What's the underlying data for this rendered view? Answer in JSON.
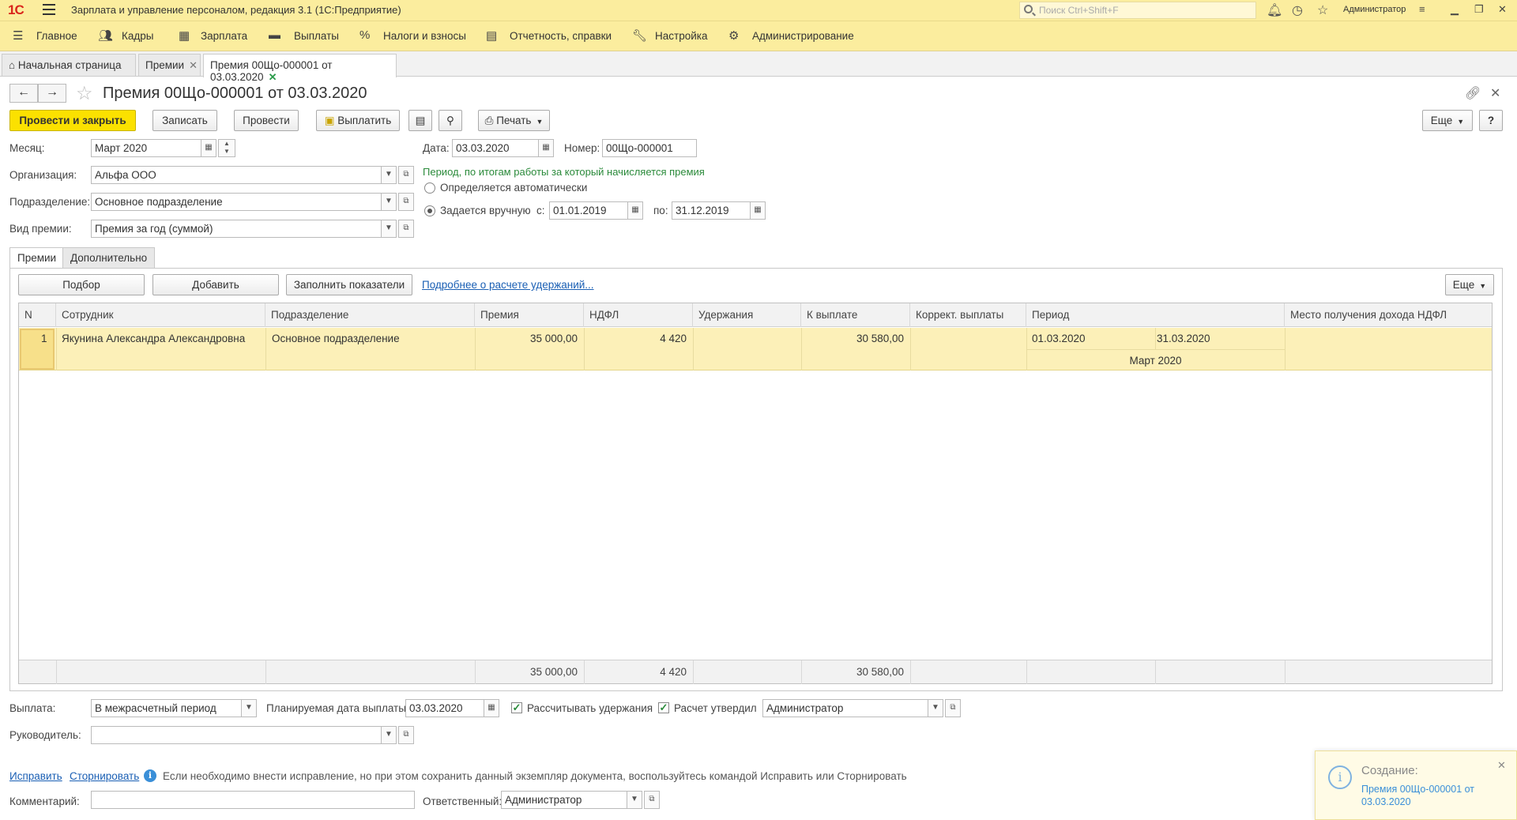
{
  "app": {
    "logo": "1С",
    "title": "Зарплата и управление персоналом, редакция 3.1  (1С:Предприятие)",
    "search_placeholder": "Поиск Ctrl+Shift+F",
    "user": "Администратор"
  },
  "main_menu": [
    {
      "label": "Главное",
      "icon": "menu-icon"
    },
    {
      "label": "Кадры",
      "icon": "people-icon"
    },
    {
      "label": "Зарплата",
      "icon": "calculator-icon"
    },
    {
      "label": "Выплаты",
      "icon": "wallet-icon"
    },
    {
      "label": "Налоги и взносы",
      "icon": "percent-icon"
    },
    {
      "label": "Отчетность, справки",
      "icon": "reports-icon"
    },
    {
      "label": "Настройка",
      "icon": "wrench-icon"
    },
    {
      "label": "Администрирование",
      "icon": "gear-icon"
    }
  ],
  "open_tabs": [
    {
      "label": "Начальная страница"
    },
    {
      "label": "Премии"
    },
    {
      "label": "Премия 00Що-000001 от 03.03.2020",
      "active": true
    }
  ],
  "form": {
    "title": "Премия 00Що-000001 от 03.03.2020",
    "buttons": {
      "post_close": "Провести и закрыть",
      "save": "Записать",
      "post": "Провести",
      "pay": "Выплатить",
      "print": "Печать",
      "more": "Еще",
      "help": "?"
    },
    "month": {
      "label": "Месяц:",
      "value": "Март 2020"
    },
    "organization": {
      "label": "Организация:",
      "value": "Альфа ООО"
    },
    "department": {
      "label": "Подразделение:",
      "value": "Основное подразделение"
    },
    "bonus_type": {
      "label": "Вид премии:",
      "value": "Премия за год (суммой)"
    },
    "date": {
      "label": "Дата:",
      "value": "03.03.2020"
    },
    "number": {
      "label": "Номер:",
      "value": "00Що-000001"
    },
    "period_note": "Период, по итогам работы за который начисляется премия",
    "period_auto": "Определяется автоматически",
    "period_manual": "Задается вручную",
    "period_from_label": "с:",
    "period_from": "01.01.2019",
    "period_to_label": "по:",
    "period_to": "31.12.2019",
    "selected_period_mode": "manual"
  },
  "form_tabs": [
    {
      "label": "Премии",
      "active": true
    },
    {
      "label": "Дополнительно"
    }
  ],
  "table_toolbar": {
    "pick": "Подбор",
    "add": "Добавить",
    "fill": "Заполнить показатели",
    "details_link": "Подробнее о расчете удержаний...",
    "more": "Еще"
  },
  "table": {
    "columns": [
      "N",
      "Сотрудник",
      "Подразделение",
      "Премия",
      "НДФЛ",
      "Удержания",
      "К выплате",
      "Коррект. выплаты",
      "Период",
      "Место получения дохода НДФЛ"
    ],
    "rows": [
      {
        "n": "1",
        "employee": "Якунина Александра Александровна",
        "department": "Основное подразделение",
        "bonus": "35 000,00",
        "ndfl": "4 420",
        "deductions": "",
        "to_pay": "30 580,00",
        "correction": "",
        "period_from": "01.03.2020",
        "period_to": "31.03.2020",
        "period_month": "Март 2020",
        "income_place": ""
      }
    ],
    "totals": {
      "bonus": "35 000,00",
      "ndfl": "4 420",
      "to_pay": "30 580,00"
    }
  },
  "footer": {
    "payment": {
      "label": "Выплата:",
      "value": "В межрасчетный период"
    },
    "planned_date": {
      "label": "Планируемая дата выплаты:",
      "value": "03.03.2020"
    },
    "calc_deductions": {
      "label": "Рассчитывать удержания",
      "checked": true
    },
    "calc_approved": {
      "label": "Расчет утвердил",
      "checked": true
    },
    "approver": "Администратор",
    "manager": {
      "label": "Руководитель:",
      "value": ""
    },
    "fix_link": "Исправить",
    "reverse_link": "Сторнировать",
    "info_text": "Если необходимо внести исправление, но при этом сохранить данный экземпляр документа, воспользуйтесь командой Исправить или Сторнировать",
    "comment": {
      "label": "Комментарий:",
      "value": ""
    },
    "responsible": {
      "label": "Ответственный:",
      "value": "Администратор"
    }
  },
  "notification": {
    "title": "Создание:",
    "link": "Премия 00Що-000001 от 03.03.2020"
  },
  "colors": {
    "chrome": "#fbed9e",
    "primary_button": "#fbe100",
    "selected_row": "#fcf0b8",
    "link": "#1a5fb4",
    "note_green": "#2a8a3a"
  }
}
